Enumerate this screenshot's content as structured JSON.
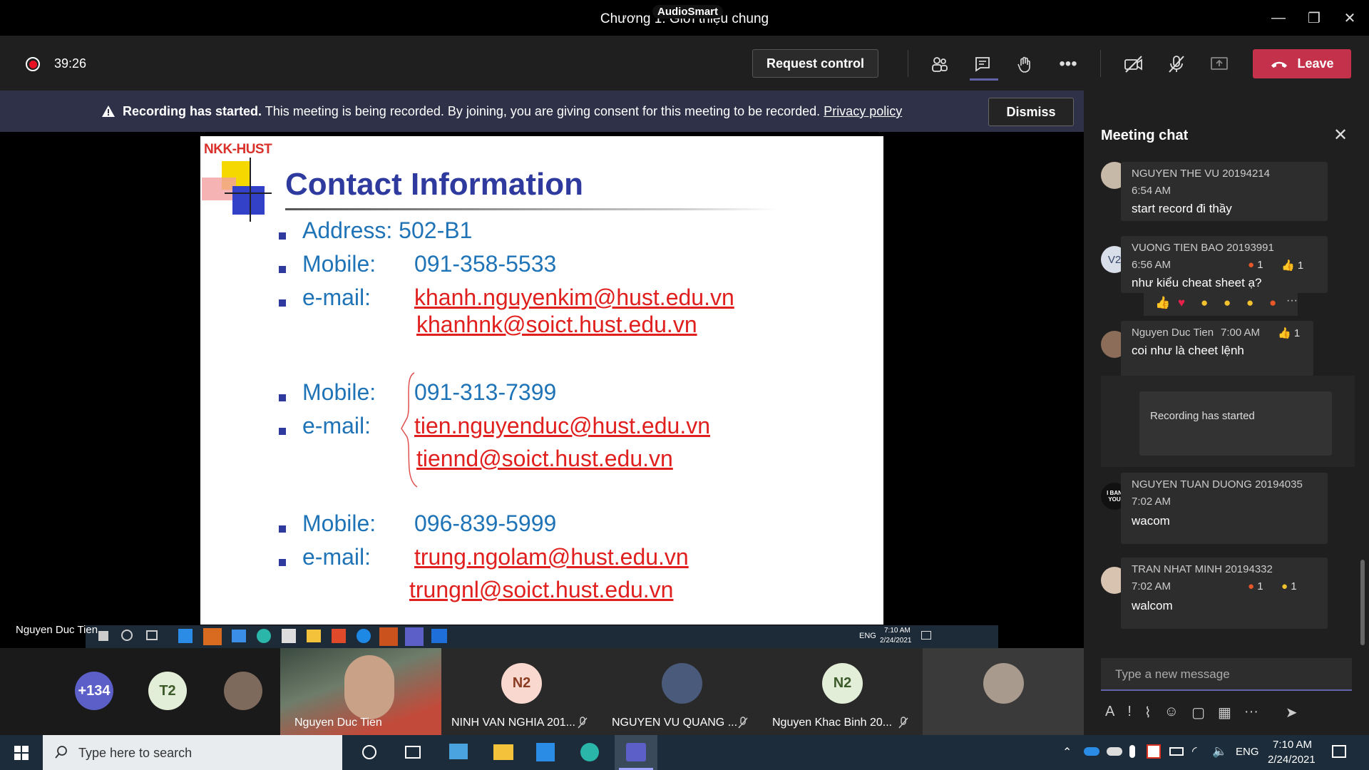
{
  "window": {
    "title": "Chương 1: Giới thiệu chung",
    "overlay_badge": "AudioSmart",
    "controls": {
      "minimize": "—",
      "maximize": "❐",
      "close": "✕"
    }
  },
  "toolbar": {
    "timer": "39:26",
    "request_control_label": "Request control",
    "leave_label": "Leave"
  },
  "banner": {
    "bold_text": "Recording has started.",
    "text": "This meeting is being recorded. By joining, you are giving consent for this meeting to be recorded.",
    "link_text": "Privacy policy",
    "dismiss_label": "Dismiss"
  },
  "slide": {
    "logo_text": "NKK-HUST",
    "title": "Contact Information",
    "address_label": "Address: 502-B1",
    "mobile_label": "Mobile:",
    "email_label": "e-mail:",
    "contact1_mobile": "091-358-5533",
    "contact1_email1": "khanh.nguyenkim@hust.edu.vn",
    "contact1_email2": "khanhnk@soict.hust.edu.vn",
    "contact2_mobile": "091-313-7399",
    "contact2_email1": "tien.nguyenduc@hust.edu.vn",
    "contact2_email2": "tiennd@soict.hust.edu.vn",
    "contact3_mobile": "096-839-5999",
    "contact3_email1": "trung.ngolam@hust.edu.vn",
    "contact3_email2": "trungnl@soict.hust.edu.vn"
  },
  "presenter": {
    "name": "Nguyen Duc Tien",
    "inner_clock_time": "7:10 AM",
    "inner_clock_date": "2/24/2021",
    "inner_lang": "ENG"
  },
  "participants": {
    "overflow_count": "+134",
    "t2_initials": "T2",
    "presenter_tile_name": "Nguyen Duc Tien",
    "tile1_initials": "N2",
    "tile1_name": "NINH VAN NGHIA 201...",
    "tile2_name": "NGUYEN VU QUANG ...",
    "tile3_initials": "N2",
    "tile3_name": "Nguyen Khac Binh 20..."
  },
  "chat": {
    "title": "Meeting chat",
    "messages": [
      {
        "author": "NGUYEN THE VU 20194214",
        "time": "6:54 AM",
        "text": "start record đi thầy"
      },
      {
        "author": "VUONG TIEN BAO 20193991",
        "initials": "V2",
        "time": "6:56 AM",
        "text": "như kiểu cheat sheet ạ?",
        "reactions": [
          "1",
          "1"
        ]
      },
      {
        "author": "Nguyen Duc Tien",
        "time": "7:00 AM",
        "text": "coi như là cheet lệnh",
        "reactions": [
          "1"
        ]
      },
      {
        "system": "Recording has started"
      },
      {
        "author": "NGUYEN TUAN DUONG 20194035",
        "avatar_text": "I BAN YOU",
        "time": "7:02 AM",
        "text": "wacom"
      },
      {
        "author": "TRAN NHAT MINH 20194332",
        "time": "7:02 AM",
        "text": "walcom",
        "reactions": [
          "1",
          "1"
        ]
      }
    ],
    "compose_placeholder": "Type a new message"
  },
  "taskbar": {
    "search_placeholder": "Type here to search",
    "lang": "ENG",
    "time": "7:10 AM",
    "date": "2/24/2021"
  },
  "colors": {
    "leave": "#c4314b",
    "banner": "#2e3148",
    "slide_blue": "#1f73b7",
    "slide_title": "#2e3a9e",
    "slide_link": "#e0201e",
    "accent": "#6264a7"
  }
}
